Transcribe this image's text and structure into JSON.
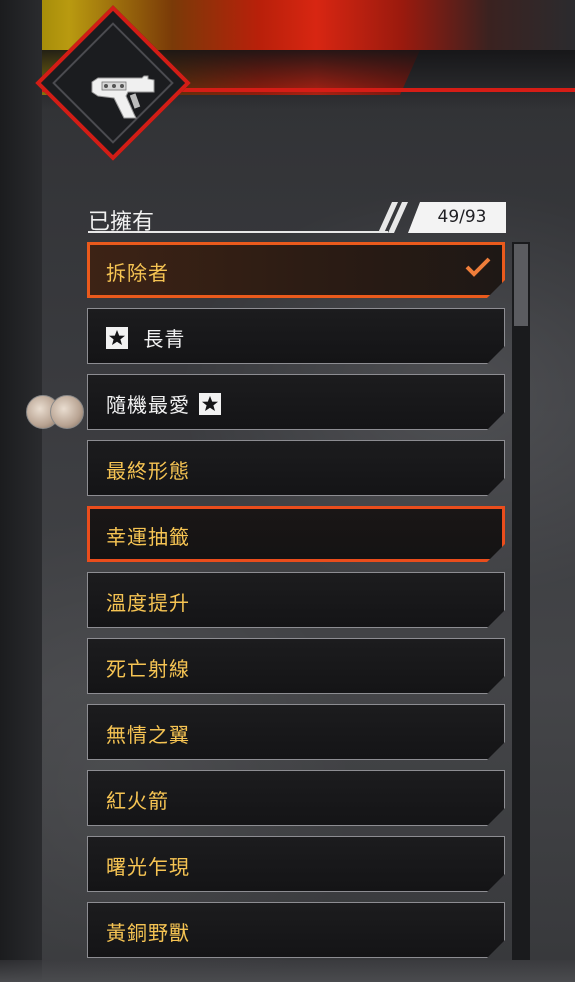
{
  "header": {
    "title": "已擁有",
    "count": "49/93"
  },
  "items": [
    {
      "label": "拆除者",
      "state": "active",
      "checked": true
    },
    {
      "label": "長青",
      "star": "before",
      "white": true
    },
    {
      "label": "隨機最愛",
      "star": "after",
      "white": true
    },
    {
      "label": "最終形態"
    },
    {
      "label": "幸運抽籤",
      "state": "selected"
    },
    {
      "label": "溫度提升"
    },
    {
      "label": "死亡射線"
    },
    {
      "label": "無情之翼"
    },
    {
      "label": "紅火箭"
    },
    {
      "label": "曙光乍現"
    },
    {
      "label": "黃銅野獸"
    }
  ],
  "colors": {
    "accent_orange": "#ea5a1c",
    "label_gold": "#f6c453",
    "emblem_red": "#d21d16"
  },
  "icons": {
    "emblem": "pistol-icon",
    "check": "check-icon",
    "star": "star-icon"
  }
}
